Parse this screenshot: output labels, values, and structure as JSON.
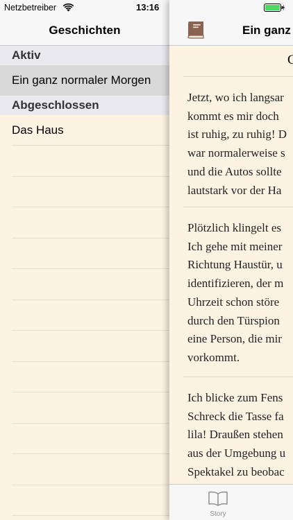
{
  "status_bar": {
    "carrier": "Netzbetreiber",
    "time": "13:16"
  },
  "master": {
    "title": "Geschichten",
    "sections": [
      {
        "header": "Aktiv",
        "items": [
          {
            "label": "Ein ganz normaler Morgen",
            "selected": true
          }
        ]
      },
      {
        "header": "Abgeschlossen",
        "items": [
          {
            "label": "Das Haus",
            "selected": false
          }
        ]
      }
    ]
  },
  "detail": {
    "title": "Ein ganz",
    "heading": "C",
    "paragraphs": [
      [
        "Jetzt, wo ich langsar",
        "kommt es mir doch",
        "ist ruhig, zu ruhig! D",
        "war normalerweise s",
        "und die Autos sollte",
        "lautstark vor der Ha"
      ],
      [
        "Plötzlich klingelt es",
        "Ich gehe mit meiner",
        "Richtung Haustür, u",
        "identifizieren, der m",
        "Uhrzeit schon störe",
        "durch den Türspion",
        "eine Person, die mir",
        "vorkommt."
      ],
      [
        "Ich blicke zum Fens",
        "Schreck die Tasse fa",
        "lila! Draußen stehen",
        "aus der Umgebung u",
        "Spektakel zu beobac"
      ]
    ]
  },
  "tab_bar": {
    "tabs": [
      {
        "label": "Story",
        "icon": "open-book-icon"
      }
    ]
  },
  "icons": {
    "status_left": "wifi-icon",
    "status_right": "battery-icon",
    "nav_right": "book-icon"
  },
  "colors": {
    "background": "#fdf3e3",
    "bar": "#f7f7f7",
    "section_header": "#e9e9ee",
    "selected_row": "#d9d9d9",
    "book_icon": "#8b6352"
  }
}
